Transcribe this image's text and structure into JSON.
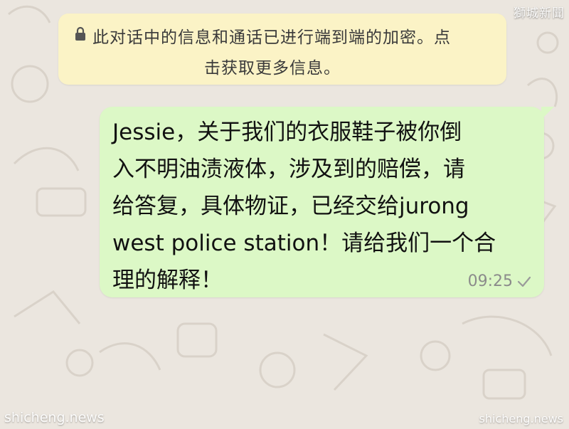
{
  "notice": {
    "icon": "lock-icon",
    "line1": "此对话中的信息和通话已进行端到端的加密。点",
    "line2": "击获取更多信息。"
  },
  "message": {
    "lines": [
      "Jessie，关于我们的衣服鞋子被你倒",
      "入不明油渍液体，涉及到的赔偿，请",
      "给答复，具体物证，已经交给jurong",
      "west police station！请给我们一个合",
      "理的解释！"
    ],
    "time": "09:25",
    "status_icon": "checkmark-icon"
  },
  "watermarks": {
    "top_right": "獅城新聞",
    "bottom_left": "shicheng.news",
    "bottom_right": "shicheng.news"
  },
  "colors": {
    "chat_background": "#ebe6df",
    "notice_background": "#fbf3c6",
    "outgoing_bubble": "#dcf8c6"
  }
}
